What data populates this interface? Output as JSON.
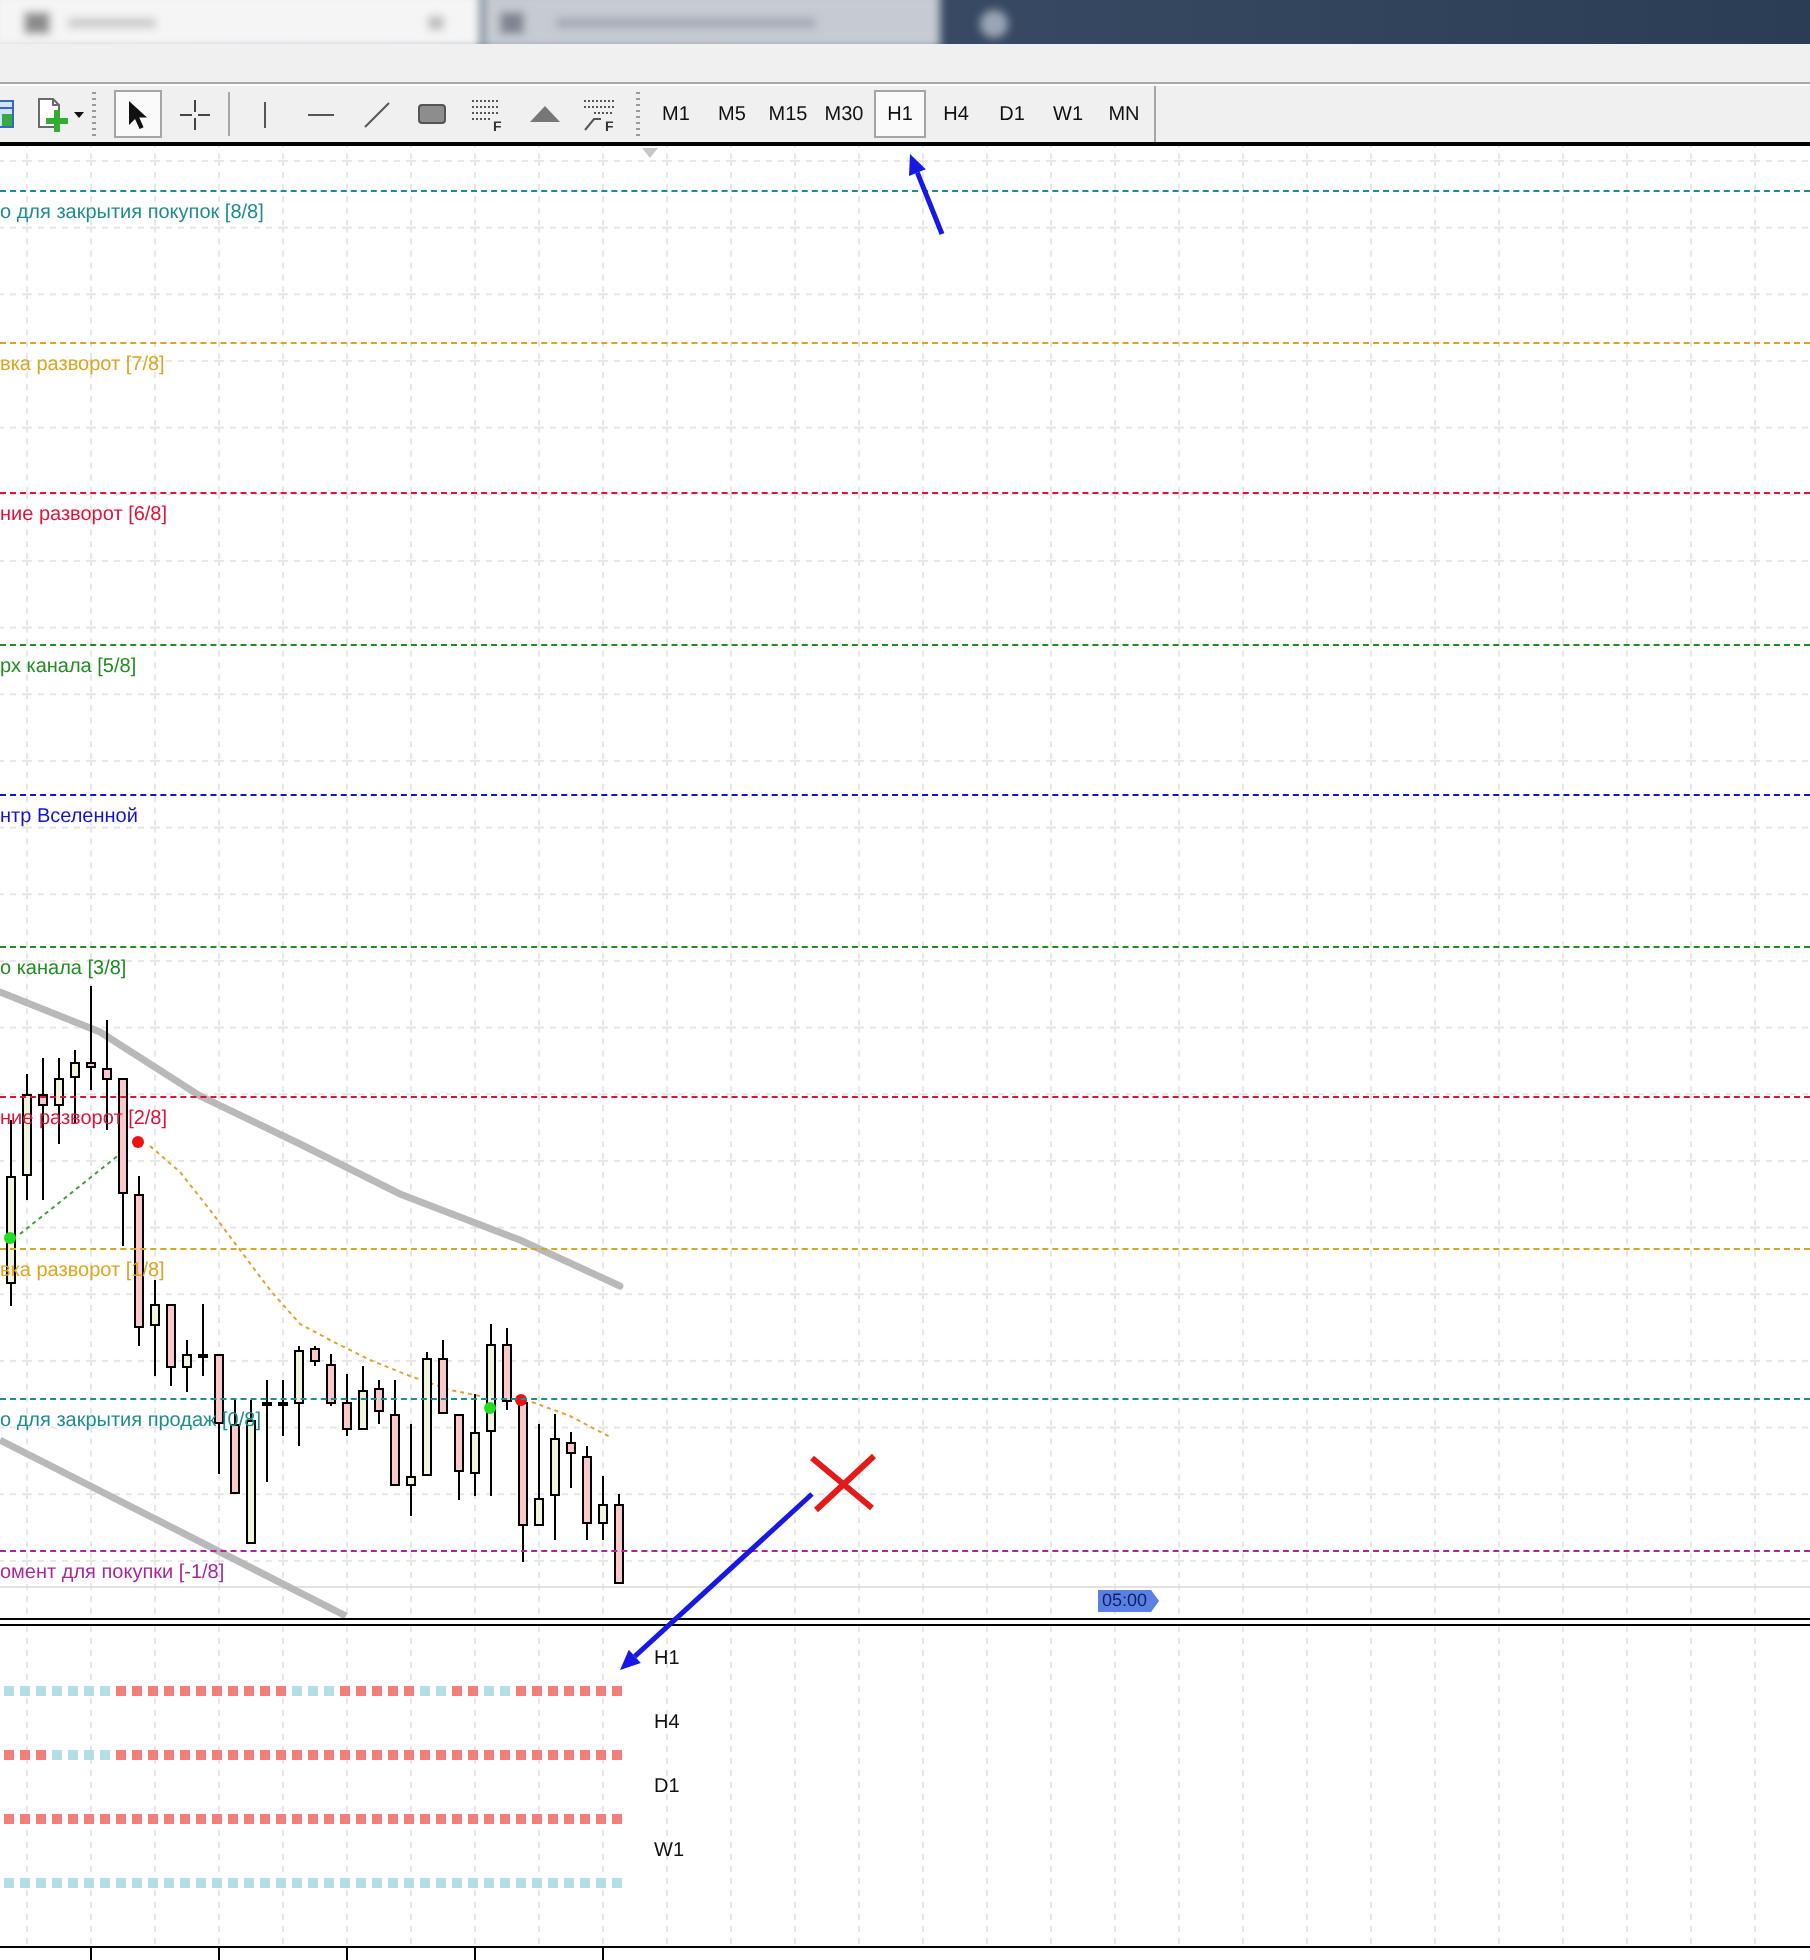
{
  "toolbar": {
    "groups": [
      {
        "tools": [
          {
            "kind": "grid",
            "selected": false
          },
          {
            "kind": "new-chart",
            "selected": false
          }
        ]
      },
      {
        "tools": [
          {
            "kind": "cursor",
            "selected": true
          },
          {
            "kind": "crosshair",
            "selected": false
          }
        ]
      },
      {
        "tools": [
          {
            "kind": "vline",
            "selected": false
          },
          {
            "kind": "hline",
            "selected": false
          },
          {
            "kind": "trendline",
            "selected": false
          },
          {
            "kind": "rectangle",
            "selected": false
          },
          {
            "kind": "fibo",
            "selected": false,
            "letter": "F"
          },
          {
            "kind": "triangle",
            "selected": false
          },
          {
            "kind": "fibo-fan",
            "selected": false,
            "letter": "F"
          }
        ]
      }
    ],
    "timeframes": [
      {
        "label": "M1",
        "selected": false
      },
      {
        "label": "M5",
        "selected": false
      },
      {
        "label": "M15",
        "selected": false
      },
      {
        "label": "M30",
        "selected": false
      },
      {
        "label": "H1",
        "selected": true
      },
      {
        "label": "H4",
        "selected": false
      },
      {
        "label": "D1",
        "selected": false
      },
      {
        "label": "W1",
        "selected": false
      },
      {
        "label": "MN",
        "selected": false
      }
    ]
  },
  "chart": {
    "levels": [
      {
        "label": "о для закрытия покупок [8/8]",
        "color": "#1e8c8c"
      },
      {
        "label": "вка разворот [7/8]",
        "color": "#daa520"
      },
      {
        "label": "ние разворот [6/8]",
        "color": "#dc143c"
      },
      {
        "label": "рх канала [5/8]",
        "color": "#228b22"
      },
      {
        "label": "нтр Вселенной",
        "color": "#1414c8"
      },
      {
        "label": "о канала [3/8]",
        "color": "#228b22"
      },
      {
        "label": "ние разворот [2/8]",
        "color": "#dc143c"
      },
      {
        "label": "вка разворот [1/8]",
        "color": "#daa520"
      },
      {
        "label": "о для закрытия продаж [0/8]",
        "color": "#1e8c8c"
      },
      {
        "label": "омент для покупки [-1/8]",
        "color": "#a8289c"
      }
    ],
    "time_label": "05:00"
  },
  "indicator": {
    "rows": [
      {
        "label": "H1",
        "cells": [
          {
            "color": "#b2dfe6"
          },
          {
            "color": "#b2dfe6"
          },
          {
            "color": "#b2dfe6"
          },
          {
            "color": "#b2dfe6"
          },
          {
            "color": "#b2dfe6"
          },
          {
            "color": "#b2dfe6"
          },
          {
            "color": "#b2dfe6"
          },
          {
            "color": "#f87c7c"
          },
          {
            "color": "#f87c7c"
          },
          {
            "color": "#f87c7c"
          },
          {
            "color": "#f87c7c"
          },
          {
            "color": "#f87c7c"
          },
          {
            "color": "#f87c7c"
          },
          {
            "color": "#f87c7c"
          },
          {
            "color": "#f87c7c"
          },
          {
            "color": "#f87c7c"
          },
          {
            "color": "#f87c7c"
          },
          {
            "color": "#f87c7c"
          },
          {
            "color": "#b2dfe6"
          },
          {
            "color": "#b2dfe6"
          },
          {
            "color": "#b2dfe6"
          },
          {
            "color": "#f87c7c"
          },
          {
            "color": "#f87c7c"
          },
          {
            "color": "#f87c7c"
          },
          {
            "color": "#f87c7c"
          },
          {
            "color": "#f87c7c"
          },
          {
            "color": "#b2dfe6"
          },
          {
            "color": "#b2dfe6"
          },
          {
            "color": "#f87c7c"
          },
          {
            "color": "#f87c7c"
          },
          {
            "color": "#b2dfe6"
          },
          {
            "color": "#b2dfe6"
          },
          {
            "color": "#f87c7c"
          },
          {
            "color": "#f87c7c"
          },
          {
            "color": "#f87c7c"
          },
          {
            "color": "#f87c7c"
          },
          {
            "color": "#f87c7c"
          },
          {
            "color": "#f87c7c"
          },
          {
            "color": "#f87c7c"
          }
        ]
      },
      {
        "label": "H4",
        "cells": [
          {
            "color": "#f87c7c"
          },
          {
            "color": "#f87c7c"
          },
          {
            "color": "#f87c7c"
          },
          {
            "color": "#b2dfe6"
          },
          {
            "color": "#b2dfe6"
          },
          {
            "color": "#b2dfe6"
          },
          {
            "color": "#b2dfe6"
          },
          {
            "color": "#f87c7c"
          },
          {
            "color": "#f87c7c"
          },
          {
            "color": "#f87c7c"
          },
          {
            "color": "#f87c7c"
          },
          {
            "color": "#f87c7c"
          },
          {
            "color": "#f87c7c"
          },
          {
            "color": "#f87c7c"
          },
          {
            "color": "#f87c7c"
          },
          {
            "color": "#f87c7c"
          },
          {
            "color": "#f87c7c"
          },
          {
            "color": "#f87c7c"
          },
          {
            "color": "#f87c7c"
          },
          {
            "color": "#f87c7c"
          },
          {
            "color": "#f87c7c"
          },
          {
            "color": "#f87c7c"
          },
          {
            "color": "#f87c7c"
          },
          {
            "color": "#f87c7c"
          },
          {
            "color": "#f87c7c"
          },
          {
            "color": "#f87c7c"
          },
          {
            "color": "#f87c7c"
          },
          {
            "color": "#f87c7c"
          },
          {
            "color": "#f87c7c"
          },
          {
            "color": "#f87c7c"
          },
          {
            "color": "#f87c7c"
          },
          {
            "color": "#f87c7c"
          },
          {
            "color": "#f87c7c"
          },
          {
            "color": "#f87c7c"
          },
          {
            "color": "#f87c7c"
          },
          {
            "color": "#f87c7c"
          },
          {
            "color": "#f87c7c"
          },
          {
            "color": "#f87c7c"
          },
          {
            "color": "#f87c7c"
          }
        ]
      },
      {
        "label": "D1",
        "cells": [
          {
            "color": "#f87c7c"
          },
          {
            "color": "#f87c7c"
          },
          {
            "color": "#f87c7c"
          },
          {
            "color": "#f87c7c"
          },
          {
            "color": "#f87c7c"
          },
          {
            "color": "#f87c7c"
          },
          {
            "color": "#f87c7c"
          },
          {
            "color": "#f87c7c"
          },
          {
            "color": "#f87c7c"
          },
          {
            "color": "#f87c7c"
          },
          {
            "color": "#f87c7c"
          },
          {
            "color": "#f87c7c"
          },
          {
            "color": "#f87c7c"
          },
          {
            "color": "#f87c7c"
          },
          {
            "color": "#f87c7c"
          },
          {
            "color": "#f87c7c"
          },
          {
            "color": "#f87c7c"
          },
          {
            "color": "#f87c7c"
          },
          {
            "color": "#f87c7c"
          },
          {
            "color": "#f87c7c"
          },
          {
            "color": "#f87c7c"
          },
          {
            "color": "#f87c7c"
          },
          {
            "color": "#f87c7c"
          },
          {
            "color": "#f87c7c"
          },
          {
            "color": "#f87c7c"
          },
          {
            "color": "#f87c7c"
          },
          {
            "color": "#f87c7c"
          },
          {
            "color": "#f87c7c"
          },
          {
            "color": "#f87c7c"
          },
          {
            "color": "#f87c7c"
          },
          {
            "color": "#f87c7c"
          },
          {
            "color": "#f87c7c"
          },
          {
            "color": "#f87c7c"
          },
          {
            "color": "#f87c7c"
          },
          {
            "color": "#f87c7c"
          },
          {
            "color": "#f87c7c"
          },
          {
            "color": "#f87c7c"
          },
          {
            "color": "#f87c7c"
          },
          {
            "color": "#f87c7c"
          }
        ]
      },
      {
        "label": "W1",
        "cells": [
          {
            "color": "#b2dfe6"
          },
          {
            "color": "#b2dfe6"
          },
          {
            "color": "#b2dfe6"
          },
          {
            "color": "#b2dfe6"
          },
          {
            "color": "#b2dfe6"
          },
          {
            "color": "#b2dfe6"
          },
          {
            "color": "#b2dfe6"
          },
          {
            "color": "#b2dfe6"
          },
          {
            "color": "#b2dfe6"
          },
          {
            "color": "#b2dfe6"
          },
          {
            "color": "#b2dfe6"
          },
          {
            "color": "#b2dfe6"
          },
          {
            "color": "#b2dfe6"
          },
          {
            "color": "#b2dfe6"
          },
          {
            "color": "#b2dfe6"
          },
          {
            "color": "#b2dfe6"
          },
          {
            "color": "#b2dfe6"
          },
          {
            "color": "#b2dfe6"
          },
          {
            "color": "#b2dfe6"
          },
          {
            "color": "#b2dfe6"
          },
          {
            "color": "#b2dfe6"
          },
          {
            "color": "#b2dfe6"
          },
          {
            "color": "#b2dfe6"
          },
          {
            "color": "#b2dfe6"
          },
          {
            "color": "#b2dfe6"
          },
          {
            "color": "#b2dfe6"
          },
          {
            "color": "#b2dfe6"
          },
          {
            "color": "#b2dfe6"
          },
          {
            "color": "#b2dfe6"
          },
          {
            "color": "#b2dfe6"
          },
          {
            "color": "#b2dfe6"
          },
          {
            "color": "#b2dfe6"
          },
          {
            "color": "#b2dfe6"
          },
          {
            "color": "#b2dfe6"
          },
          {
            "color": "#b2dfe6"
          },
          {
            "color": "#b2dfe6"
          },
          {
            "color": "#b2dfe6"
          },
          {
            "color": "#b2dfe6"
          },
          {
            "color": "#b2dfe6"
          }
        ]
      }
    ]
  }
}
